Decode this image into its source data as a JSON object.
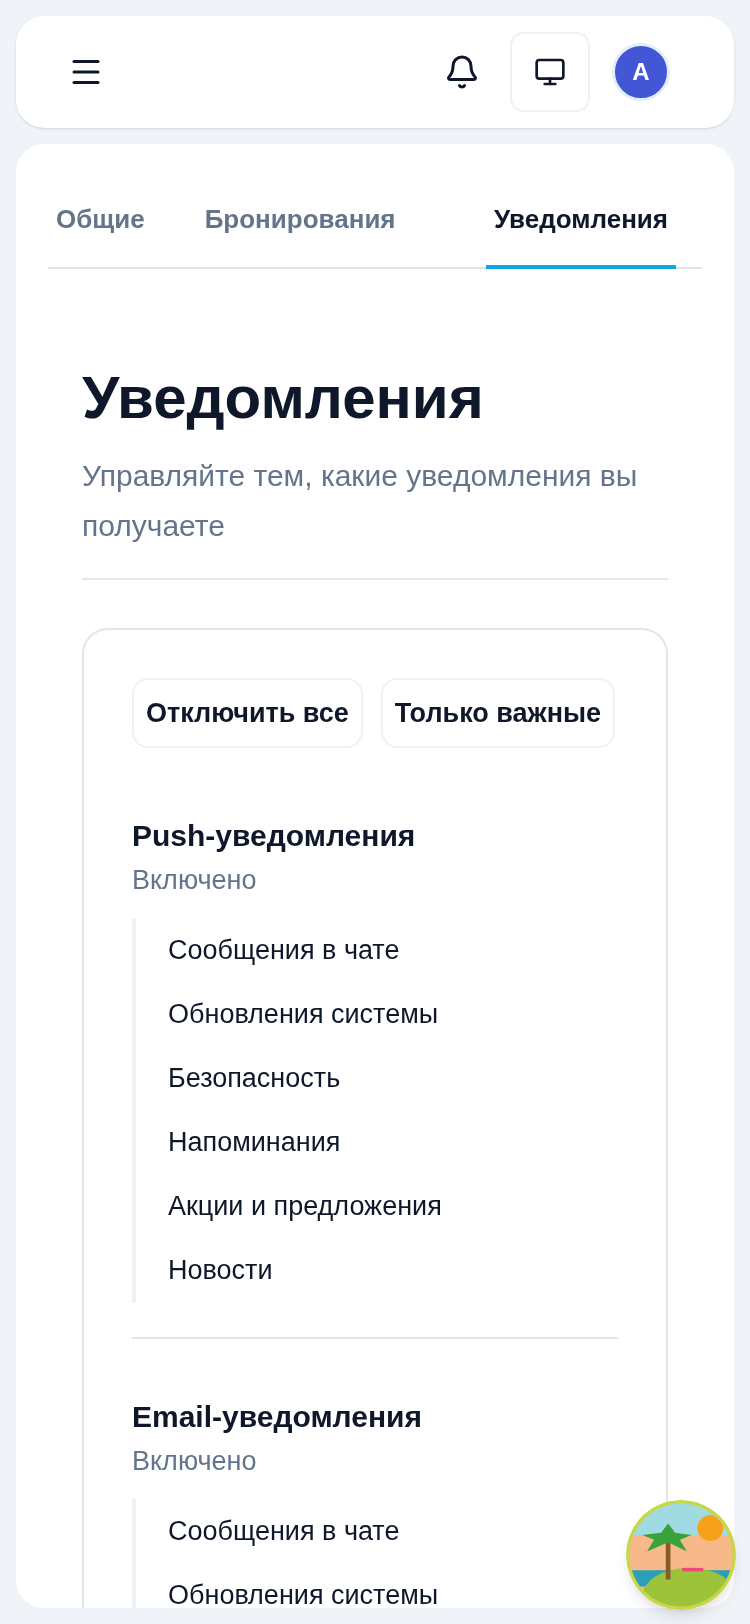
{
  "header": {
    "avatar": "A"
  },
  "tabs": [
    {
      "label": "Общие",
      "selected": false
    },
    {
      "label": "Бронирования",
      "selected": false
    },
    {
      "label": "Уведомления",
      "selected": true
    }
  ],
  "title": "Уведомления",
  "subtitle": "Управляйте тем, какие уведомления вы получаете",
  "actions": [
    "Отключить все",
    "Только важные"
  ],
  "sections": [
    {
      "title": "Push-уведомления",
      "status": "Включено",
      "items": [
        "Сообщения в чате",
        "Обновления системы",
        "Безопасность",
        "Напоминания",
        "Акции и предложения",
        "Новости"
      ]
    },
    {
      "title": "Email-уведомления",
      "status": "Включено",
      "items": [
        "Сообщения в чате",
        "Обновления системы"
      ]
    }
  ]
}
